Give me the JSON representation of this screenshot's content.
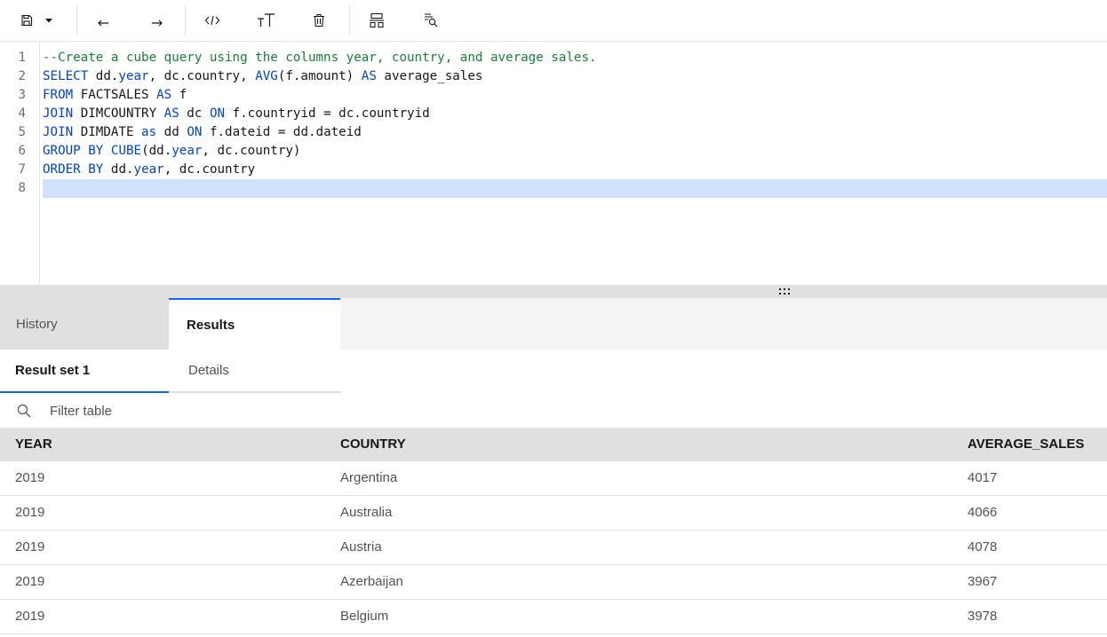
{
  "toolbar": {
    "buttons": [
      {
        "name": "save-icon"
      },
      {
        "name": "chevron-down-icon"
      },
      {
        "name": "undo-icon"
      },
      {
        "name": "redo-icon"
      },
      {
        "name": "code-icon"
      },
      {
        "name": "text-size-icon"
      },
      {
        "name": "trash-icon"
      },
      {
        "name": "format-icon"
      },
      {
        "name": "search-replace-icon"
      }
    ]
  },
  "editor": {
    "line_numbers": [
      "1",
      "2",
      "3",
      "4",
      "5",
      "6",
      "7",
      "8"
    ],
    "lines": [
      "--Create a cube query using the columns year, country, and average sales.",
      "SELECT dd.year, dc.country, AVG(f.amount) AS average_sales",
      "FROM FACTSALES AS f",
      "JOIN DIMCOUNTRY AS dc ON f.countryid = dc.countryid",
      "JOIN DIMDATE as dd ON f.dateid = dd.dateid",
      "GROUP BY CUBE(dd.year, dc.country)",
      "ORDER BY dd.year, dc.country",
      ""
    ],
    "active_line": 8,
    "keyword_color": "#0043ce",
    "comment_color": "#198038"
  },
  "tabs": {
    "history": "History",
    "results": "Results"
  },
  "subtabs": {
    "result_set": "Result set 1",
    "details": "Details"
  },
  "filter": {
    "placeholder": "Filter table"
  },
  "table": {
    "columns": [
      "YEAR",
      "COUNTRY",
      "AVERAGE_SALES"
    ],
    "rows": [
      [
        "2019",
        "Argentina",
        "4017"
      ],
      [
        "2019",
        "Australia",
        "4066"
      ],
      [
        "2019",
        "Austria",
        "4078"
      ],
      [
        "2019",
        "Azerbaijan",
        "3967"
      ],
      [
        "2019",
        "Belgium",
        "3978"
      ]
    ]
  },
  "colors": {
    "accent": "#0f62fe",
    "active_line": "#d0e2ff"
  }
}
